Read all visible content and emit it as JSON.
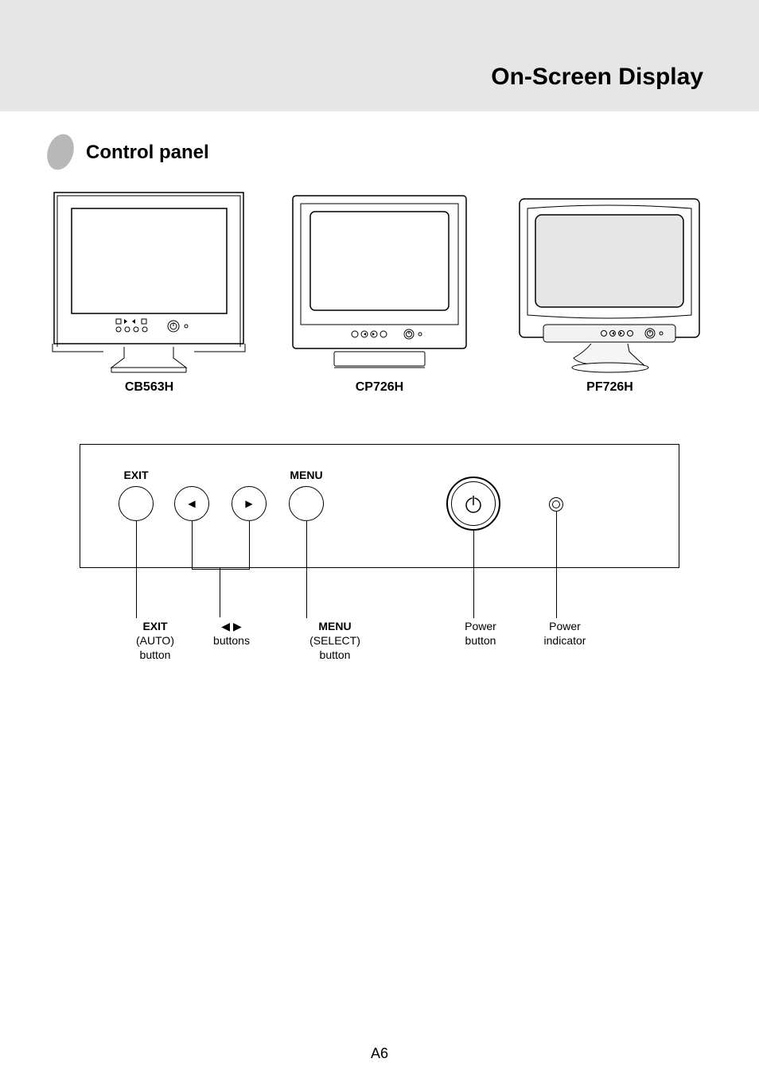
{
  "header": {
    "title": "On-Screen Display"
  },
  "section": {
    "title": "Control panel"
  },
  "monitors": [
    {
      "label": "CB563H"
    },
    {
      "label": "CP726H"
    },
    {
      "label": "PF726H"
    }
  ],
  "panel": {
    "exit_top": "EXIT",
    "menu_top": "MENU"
  },
  "callouts": {
    "exit": {
      "label": "EXIT",
      "desc": "(AUTO)\nbutton"
    },
    "dir": {
      "desc": "◀ ▶\nbuttons"
    },
    "menu": {
      "label": "MENU",
      "desc": "(SELECT)\nbutton"
    },
    "power": {
      "desc": "Power\nbutton"
    },
    "led": {
      "desc": "Power\nindicator"
    }
  },
  "page_number": "A6"
}
